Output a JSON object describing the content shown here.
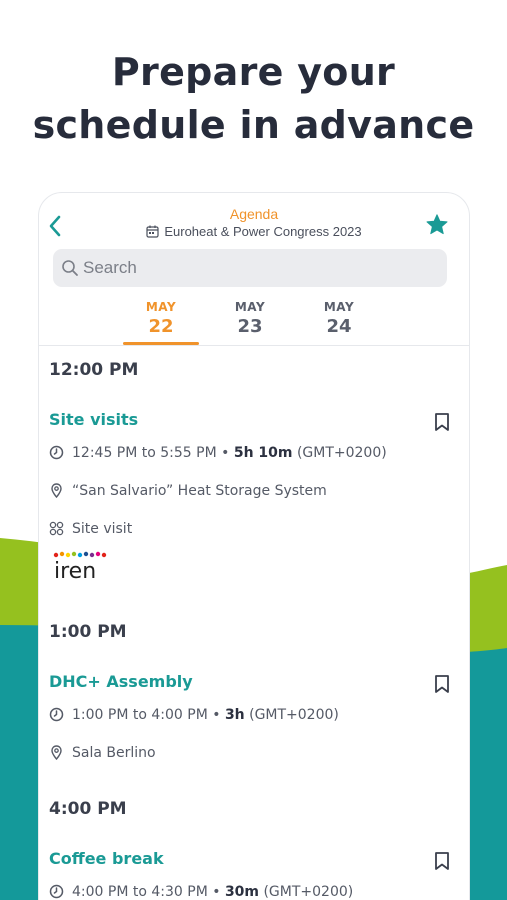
{
  "headline": {
    "line1": "Prepare your",
    "line2": "schedule in advance"
  },
  "colors": {
    "teal": "#1a9a95",
    "orange": "#f0932b",
    "lime": "#95c11f",
    "dark_teal": "#14999a"
  },
  "topbar": {
    "back_icon": "chevron-left-icon",
    "title": "Agenda",
    "event_name": "Euroheat & Power Congress 2023",
    "calendar_icon": "calendar-icon",
    "star_icon": "star-icon"
  },
  "search": {
    "placeholder": "Search",
    "value": ""
  },
  "days": [
    {
      "month": "MAY",
      "day": "22",
      "active": true
    },
    {
      "month": "MAY",
      "day": "23",
      "active": false
    },
    {
      "month": "MAY",
      "day": "24",
      "active": false
    }
  ],
  "schedule": [
    {
      "time": "12:00 PM",
      "event": {
        "title": "Site visits",
        "time_range": "12:45 PM to 5:55 PM • ",
        "duration": "5h 10m",
        "timezone": " (GMT+0200)",
        "location": "“San Salvario” Heat Storage System",
        "type": "Site visit",
        "logo_text": "iren"
      }
    },
    {
      "time": "1:00 PM",
      "event": {
        "title": "DHC+ Assembly",
        "time_range": "1:00 PM to 4:00 PM • ",
        "duration": "3h",
        "timezone": " (GMT+0200)",
        "location": "Sala Berlino"
      }
    },
    {
      "time": "4:00 PM",
      "event": {
        "title": "Coffee break",
        "time_range": "4:00 PM to 4:30 PM • ",
        "duration": "30m",
        "timezone": " (GMT+0200)"
      }
    }
  ]
}
